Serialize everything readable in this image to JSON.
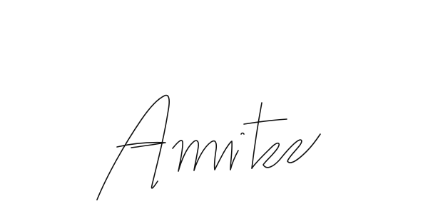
{
  "signature": {
    "text": "Amitee",
    "ink_color": "#111111",
    "background_color": "#ffffff"
  }
}
